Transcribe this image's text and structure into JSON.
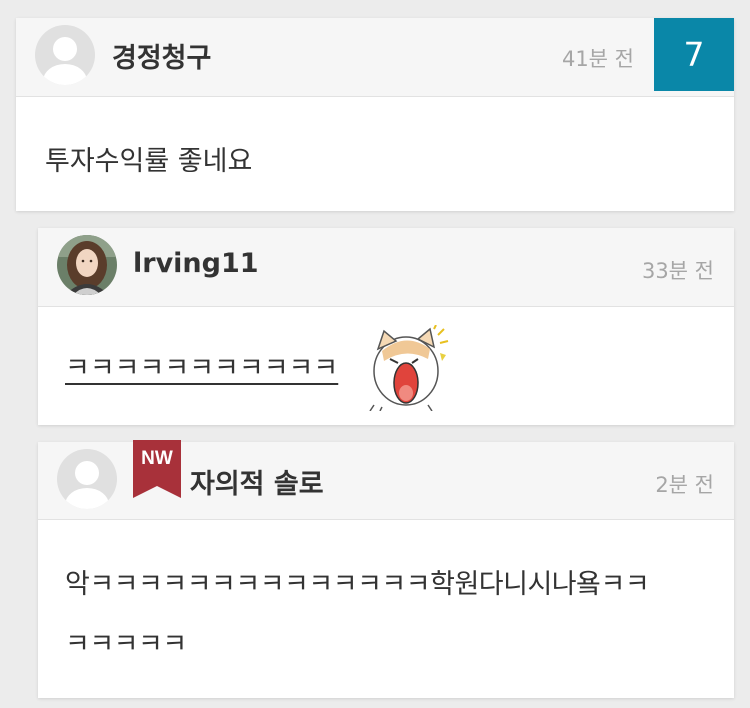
{
  "comments": [
    {
      "author": "경정청구",
      "time": "41분 전",
      "count": "7",
      "body": "투자수익률 좋네요",
      "avatar_icon": "default-user-avatar"
    },
    {
      "author": "lrving11",
      "time": "33분 전",
      "body": "ㅋㅋㅋㅋㅋㅋㅋㅋㅋㅋㅋ",
      "avatar_icon": "profile-photo-avatar",
      "emoticon": "surprised-cat-emoticon"
    },
    {
      "author": "자의적 솔로",
      "time": "2분 전",
      "badge": "NW",
      "body_line1": "악ㅋㅋㅋㅋㅋㅋㅋㅋㅋㅋㅋㅋㅋㅋ학원다니시나욬ㅋㅋ",
      "body_line2": "ㅋㅋㅋㅋㅋ",
      "avatar_icon": "default-user-avatar"
    }
  ],
  "colors": {
    "count_badge": "#0a87a8",
    "nw_badge": "#a8313a",
    "background": "#ececec"
  }
}
